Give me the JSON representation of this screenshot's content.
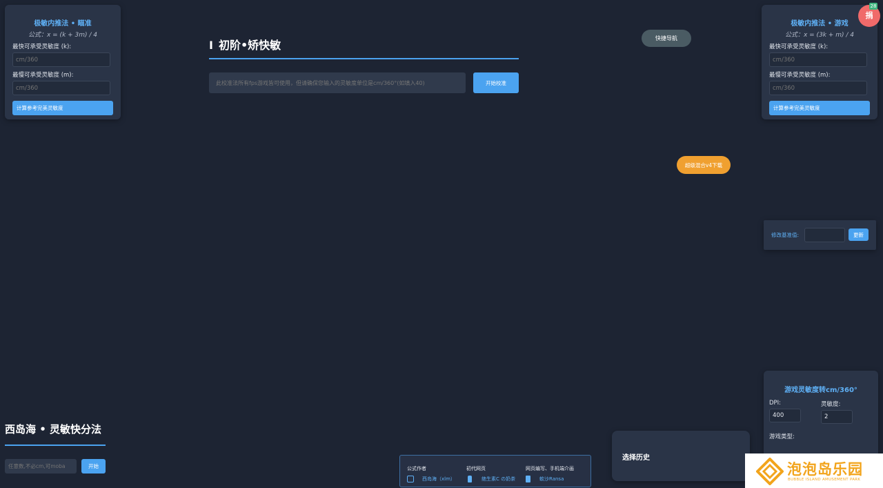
{
  "left_calc": {
    "title": "极敏内推法 • 瞄准",
    "formula": "公式：x = (k + 3m) / 4",
    "fast_label": "最快可承受灵敏度 (k):",
    "fast_placeholder": "cm/360",
    "slow_label": "最慢可承受灵敏度 (m):",
    "slow_placeholder": "cm/360",
    "button": "计算参考完美灵敏度"
  },
  "right_calc": {
    "title": "极敏内推法 • 游戏",
    "formula": "公式：x = (3k + m) / 4",
    "fast_label": "最快可承受灵敏度 (k):",
    "fast_placeholder": "cm/360",
    "slow_label": "最慢可承受灵敏度 (m):",
    "slow_placeholder": "cm/360",
    "button": "计算参考完美灵敏度"
  },
  "main": {
    "roman": "I",
    "heading": "初阶•矫快敏",
    "input_placeholder": "此校准法所有fps游戏皆可使用，但请确保您输入的灵敏度单位是cm/360°(如填入40)",
    "start_button": "开始校准"
  },
  "quick_nav": "快捷导航",
  "donate": {
    "label": "捐",
    "badge": "28"
  },
  "download_button": "超级混合v4下载",
  "baseline": {
    "label": "修改基准值:",
    "input_value": "",
    "button": "更新"
  },
  "convert": {
    "title": "游戏灵敏度转cm/360°",
    "dpi_label": "DPI:",
    "dpi_value": "400",
    "sens_label": "灵敏度:",
    "sens_value": "2",
    "game_type_label": "游戏类型:"
  },
  "history": {
    "title": "选择历史"
  },
  "bottom": {
    "title": "西岛海 • 灵敏快分法",
    "input_placeholder": "任意数,不必cm,可moba",
    "start_button": "开始"
  },
  "credits": [
    {
      "role": "公式作者",
      "name": "西岛海（xlm）",
      "icon": "square-icon"
    },
    {
      "role": "初代网页",
      "name": "绝生素C の奶茶",
      "icon": "bottle-icon"
    },
    {
      "role": "网页编写、手机端介画",
      "name": "軟沙Ransa",
      "icon": "phone-icon"
    }
  ],
  "watermark": {
    "cn": "泡泡岛乐园",
    "en": "BUBBLE ISLAND AMUSEMENT PARK"
  },
  "colors": {
    "background": "#1d2433",
    "panel": "#2a3447",
    "accent": "#4ba3f0",
    "orange": "#f0a030",
    "donate": "#f06a6a"
  }
}
